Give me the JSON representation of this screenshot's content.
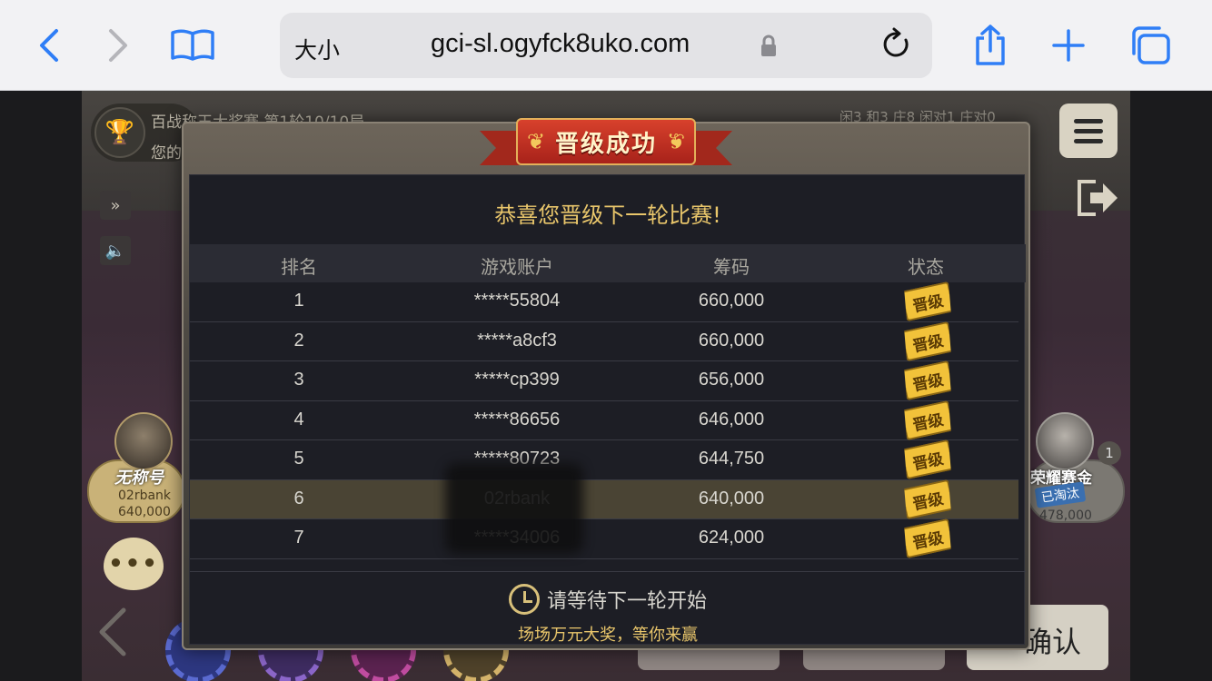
{
  "browser": {
    "text_size_label": "大小",
    "url": "gci-sl.ogyfck8uko.com"
  },
  "game": {
    "tournament_line1": "百战称王大奖赛 第1轮10/10局",
    "tournament_line2": "您的",
    "score_strip": "闲3  和3  庄8  闲对1  庄对0",
    "left_player": {
      "title": "无称号",
      "name": "02rbank",
      "chips": "640,000"
    },
    "right_player": {
      "title": "荣耀赛金",
      "status": "已淘汰",
      "chips": "478,000",
      "badge": "1"
    },
    "confirm_label": "确认"
  },
  "modal": {
    "banner_title": "晋级成功",
    "congrats": "恭喜您晋级下一轮比赛!",
    "columns": [
      "排名",
      "游戏账户",
      "筹码",
      "状态"
    ],
    "rows": [
      {
        "rank": "1",
        "account": "*****55804",
        "chips": "660,000",
        "status": "晋级"
      },
      {
        "rank": "2",
        "account": "*****a8cf3",
        "chips": "660,000",
        "status": "晋级"
      },
      {
        "rank": "3",
        "account": "*****cp399",
        "chips": "656,000",
        "status": "晋级"
      },
      {
        "rank": "4",
        "account": "*****86656",
        "chips": "646,000",
        "status": "晋级"
      },
      {
        "rank": "5",
        "account": "*****80723",
        "chips": "644,750",
        "status": "晋级"
      },
      {
        "rank": "6",
        "account": "02rbank",
        "chips": "640,000",
        "status": "晋级"
      },
      {
        "rank": "7",
        "account": "*****34006",
        "chips": "624,000",
        "status": "晋级"
      }
    ],
    "highlight_index": 5,
    "wait_text": "请等待下一轮开始",
    "promo_text": "场场万元大奖，等你来赢"
  },
  "colors": {
    "accent_gold": "#e9c66b",
    "safari_blue": "#2f7ef6",
    "banner_red": "#a8221a"
  }
}
